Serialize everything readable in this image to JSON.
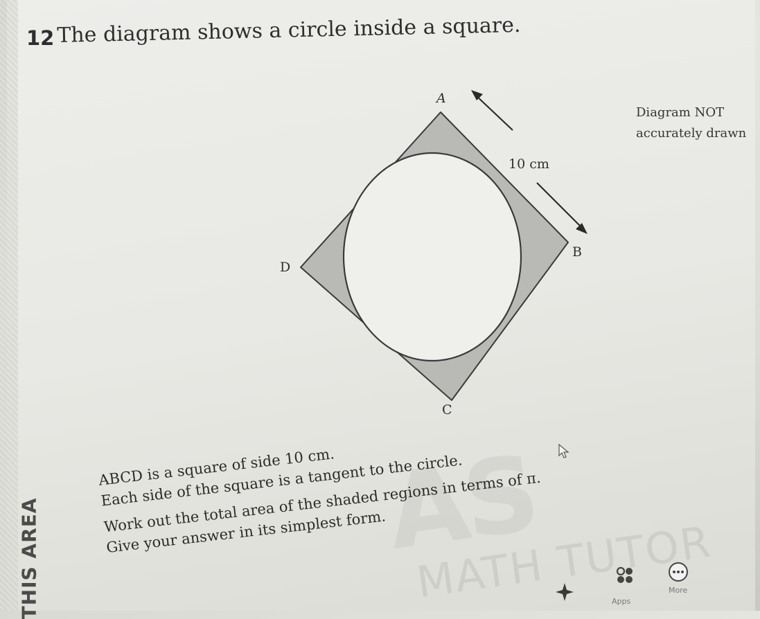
{
  "question": {
    "number": "12",
    "intro": "The diagram shows a circle inside a square.",
    "note_line1": "Diagram NOT",
    "note_line2": "accurately drawn",
    "body": [
      "ABCD is a square of side 10 cm.",
      "Each side of the square is a tangent to the circle.",
      "Work out the total area of the shaded regions in terms of π.",
      "Give your answer in its simplest form."
    ]
  },
  "diagram": {
    "vertex_a": "A",
    "vertex_b": "B",
    "vertex_c": "C",
    "vertex_d": "D",
    "side_label": "10 cm",
    "shade_color": "#b9b9b6",
    "circle_color": "#efefec"
  },
  "side_tab": {
    "label": "THIS AREA"
  },
  "watermark": {
    "big": "AS",
    "small": "MATH TUTOR"
  },
  "taskbar": {
    "apps_label": "Apps",
    "more_label": "More",
    "icons": [
      "copilot-sparkle-icon",
      "apps-icon",
      "more-icon"
    ]
  }
}
